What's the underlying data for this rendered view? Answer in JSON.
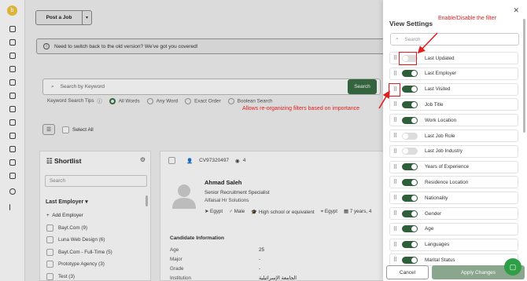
{
  "main": {
    "post_job_label": "Post a Job",
    "info_banner": "Need to switch back to the old version? We've got you covered!",
    "search_placeholder": "Search by Keyword",
    "search_button": "Search",
    "tips_label": "Keyword Search Tips",
    "tip_options": [
      "All Words",
      "Any Word",
      "Exact Order",
      "Boolean Search"
    ],
    "select_all": "Select All"
  },
  "shortlist": {
    "title": "Shortlist",
    "search_placeholder": "Search",
    "last_employer": "Last Employer",
    "add_employer": "Add Employer",
    "items": [
      "Bayt.Com (9)",
      "Luna Web Design (6)",
      "Bayt.Com - Full-Time (5)",
      "Prototype Agency (3)",
      "Test (3)"
    ]
  },
  "candidate": {
    "id": "CV97320497",
    "views": "4",
    "name": "Ahmad Saleh",
    "position": "Senior Recruitment Specialist",
    "company": "Alfaisal Hr Solutions",
    "meta": [
      "Egypt",
      "Male",
      "High school or equivalent",
      "Egypt",
      "7 years, 4"
    ],
    "info_heading": "Candidate Information",
    "rows": [
      {
        "label": "Age",
        "value": "25"
      },
      {
        "label": "Major",
        "value": "-"
      },
      {
        "label": "Grade",
        "value": "-"
      },
      {
        "label": "Institution",
        "value": "الجامعة الإسرائيلية"
      }
    ]
  },
  "view_settings": {
    "title": "View Settings",
    "search_placeholder": "Search",
    "filters": [
      {
        "label": "Last Updated",
        "on": false
      },
      {
        "label": "Last Employer",
        "on": true
      },
      {
        "label": "Last Visited",
        "on": true
      },
      {
        "label": "Job Title",
        "on": true
      },
      {
        "label": "Work Location",
        "on": true
      },
      {
        "label": "Last Job Role",
        "on": false
      },
      {
        "label": "Last Job Industry",
        "on": false
      },
      {
        "label": "Years of Experience",
        "on": true
      },
      {
        "label": "Residence Location",
        "on": true
      },
      {
        "label": "Nationality",
        "on": true
      },
      {
        "label": "Gender",
        "on": true
      },
      {
        "label": "Age",
        "on": true
      },
      {
        "label": "Languages",
        "on": true
      },
      {
        "label": "Marital Status",
        "on": true
      }
    ],
    "cancel": "Cancel",
    "apply": "Apply Changes"
  },
  "annotations": {
    "toggle_note": "Enable/Disable the filter",
    "drag_note": "Allows re-organizing filters based on importance"
  },
  "colors": {
    "accent": "#2f5f3a",
    "annotation": "#e02020"
  }
}
